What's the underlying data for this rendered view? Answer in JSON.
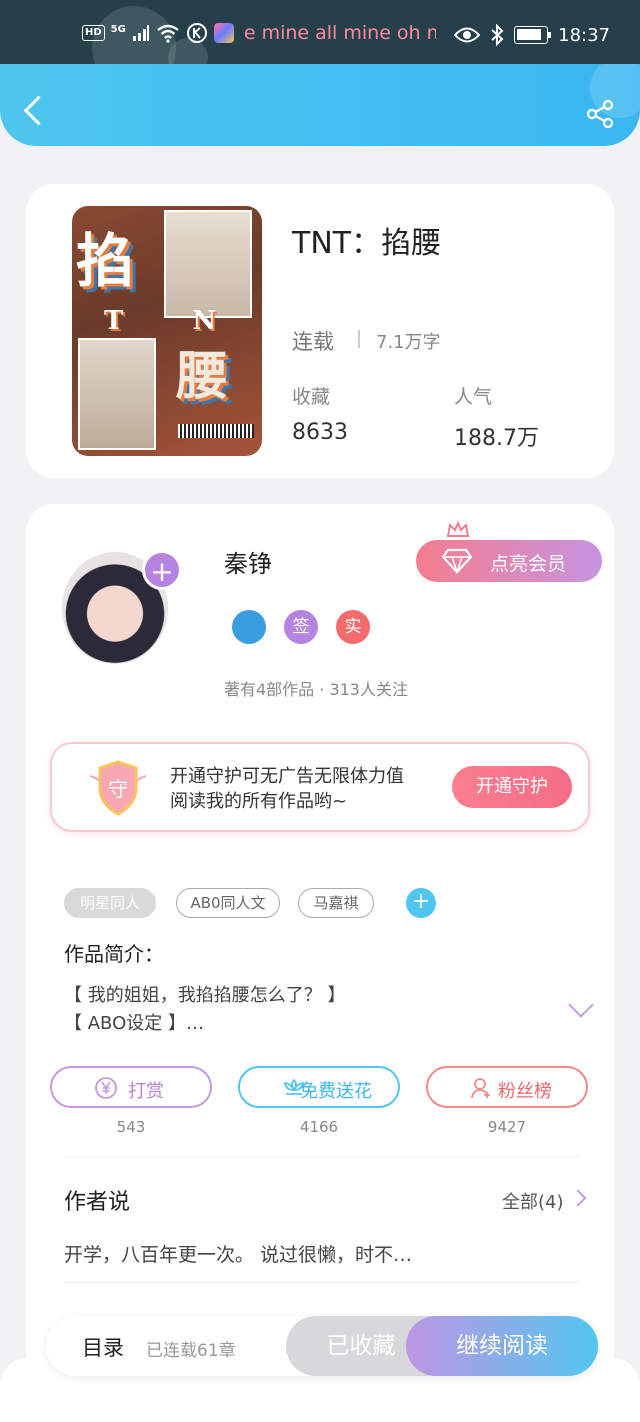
{
  "status_bar": {
    "hd": "HD",
    "network": "5G",
    "ticker": "e mine all mine oh mine",
    "time": "18:37"
  },
  "book": {
    "title": "TNT：掐腰",
    "status": "连载",
    "words": "7.1万字",
    "favorites_label": "收藏",
    "favorites_value": "8633",
    "popularity_label": "人气",
    "popularity_value": "188.7万",
    "cover_text": {
      "top": "掐",
      "middle": "T N T",
      "bottom": "腰"
    }
  },
  "author": {
    "name": "秦铮",
    "badges": [
      {
        "label": "",
        "color": "#3a9de0"
      },
      {
        "label": "签",
        "color": "#b583e0"
      },
      {
        "label": "实",
        "color": "#f56b6b"
      }
    ],
    "meta": "著有4部作品 · 313人关注",
    "vip_label": "点亮会员"
  },
  "guard": {
    "shield_char": "守",
    "line1": "开通守护可无广告无限体力值",
    "line2": "阅读我的所有作品哟~",
    "button": "开通守护"
  },
  "tags": [
    "明星同人",
    "AB0同人文",
    "马嘉祺"
  ],
  "intro": {
    "title": "作品简介：",
    "line1": "【 我的姐姐，我掐掐腰怎么了？ 】",
    "line2": "【 ABO设定 】…"
  },
  "actions": [
    {
      "label": "打赏",
      "count": "543",
      "color": "#c59adf",
      "icon": "yen-coin-icon"
    },
    {
      "label": "免费送花",
      "count": "4166",
      "color": "#4ec6ef",
      "icon": "flower-icon"
    },
    {
      "label": "粉丝榜",
      "count": "9427",
      "color": "#f08a8a",
      "icon": "fan-icon"
    }
  ],
  "author_says": {
    "title": "作者说",
    "all_link": "全部(4)",
    "text": "开学，八百年更一次。 说过很懒，时不…"
  },
  "bottom_bar": {
    "toc": "目录",
    "chapters": "已连载61章",
    "favorited": "已收藏",
    "continue": "继续阅读"
  }
}
